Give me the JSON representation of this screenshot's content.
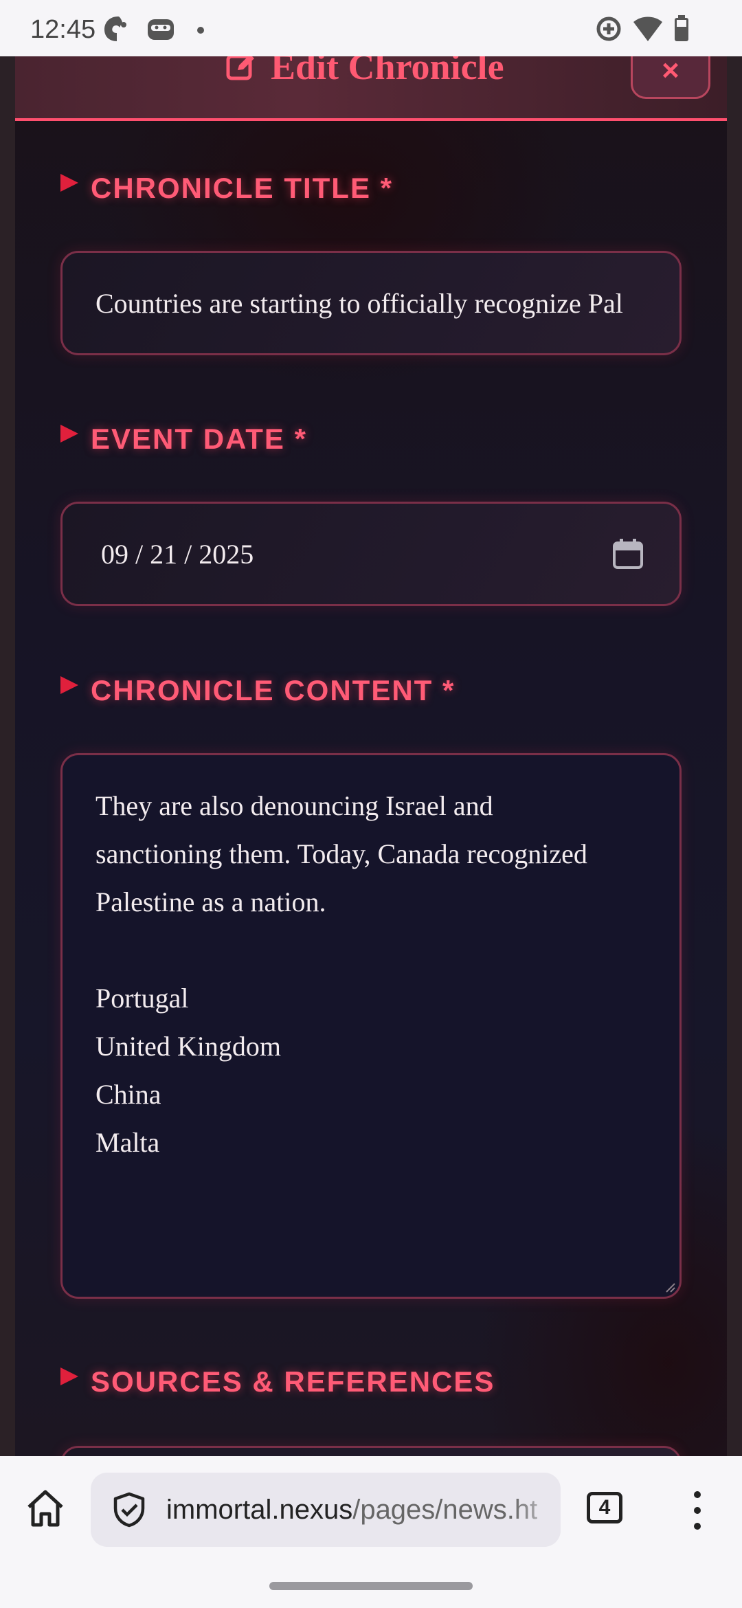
{
  "status_bar": {
    "time": "12:45",
    "left_icons": [
      "parrot-app-icon",
      "ninja-app-icon",
      "dot-icon"
    ],
    "right_icons": [
      "data-saver-icon",
      "wifi-icon",
      "battery-icon"
    ]
  },
  "modal": {
    "title": "Edit Chronicle",
    "close_label": "×",
    "fields": {
      "title": {
        "label": "CHRONICLE TITLE *",
        "value": "Countries are starting to officially recognize Pal"
      },
      "date": {
        "label": "EVENT DATE *",
        "value": "09 / 21 / 2025"
      },
      "content": {
        "label": "CHRONICLE CONTENT *",
        "lines": [
          "They are also denouncing Israel and",
          "sanctioning them. Today, Canada recognized",
          "Palestine as a nation.",
          "",
          "Portugal",
          "United Kingdom",
          "China",
          "Malta"
        ]
      },
      "sources": {
        "label": "SOURCES & REFERENCES"
      }
    }
  },
  "browser": {
    "url_host": "immortal.nexus",
    "url_path": "/pages/news.ht",
    "tab_count": "4"
  },
  "colors": {
    "accent": "#ff5b76",
    "field_border": "#7a2f48",
    "modal_bg": "#171425"
  }
}
